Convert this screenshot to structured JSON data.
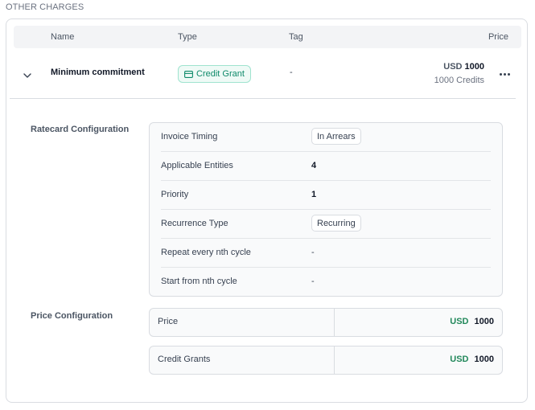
{
  "section": {
    "title": "OTHER CHARGES"
  },
  "table": {
    "headers": {
      "name": "Name",
      "type": "Type",
      "tag": "Tag",
      "price": "Price"
    },
    "row": {
      "name": "Minimum commitment",
      "type_badge": "Credit Grant",
      "tag": "-",
      "price_currency": "USD",
      "price_amount": "1000",
      "price_credits": "1000 Credits"
    }
  },
  "ratecard": {
    "label": "Ratecard Configuration",
    "rows": [
      {
        "key": "Invoice Timing",
        "value": "In Arrears"
      },
      {
        "key": "Applicable Entities",
        "value": "4"
      },
      {
        "key": "Priority",
        "value": "1"
      },
      {
        "key": "Recurrence Type",
        "value": "Recurring"
      },
      {
        "key": "Repeat every nth cycle",
        "value": "-"
      },
      {
        "key": "Start from nth cycle",
        "value": "-"
      }
    ]
  },
  "price_config": {
    "label": "Price Configuration",
    "rows": [
      {
        "key": "Price",
        "currency": "USD",
        "amount": "1000"
      },
      {
        "key": "Credit Grants",
        "currency": "USD",
        "amount": "1000"
      }
    ]
  },
  "colors": {
    "accent_green": "#0f8a6a",
    "currency_green": "#22885b",
    "border": "#d9dce1"
  },
  "icons": {
    "expand": "chevron-down-icon",
    "badge": "credit-card-icon",
    "menu": "more-horizontal-icon"
  }
}
